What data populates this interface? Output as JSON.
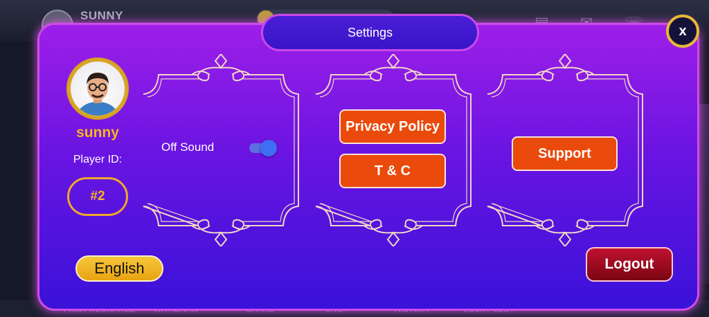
{
  "background": {
    "player_name": "SUNNY",
    "bottom_nav": [
      "FIRST RECHARGE",
      "WITHDRAW",
      "SHARE",
      "SHOP",
      "HISTORY",
      "LUCKY SLOT"
    ],
    "icons": [
      "notice-icon",
      "mail-icon",
      "support-icon",
      "settings-icon"
    ]
  },
  "modal": {
    "title": "Settings",
    "close_label": "x"
  },
  "profile": {
    "name": "sunny",
    "player_id_label": "Player ID:",
    "player_id": "#2",
    "avatar_icon": "player-avatar-icon"
  },
  "sound_panel": {
    "label": "Off Sound",
    "toggle_on": true
  },
  "policy_panel": {
    "privacy_label": "Privacy Policy",
    "tc_label": "T & C"
  },
  "support_panel": {
    "support_label": "Support"
  },
  "footer": {
    "language_label": "English",
    "logout_label": "Logout"
  },
  "colors": {
    "modal_top": "#9d1fe8",
    "modal_bottom": "#3a12d8",
    "accent_gold": "#f6b423",
    "button_orange": "#ea4a0c",
    "logout_red": "#c01230"
  }
}
